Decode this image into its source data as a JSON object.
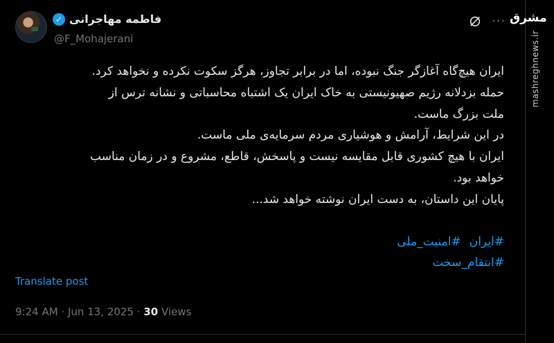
{
  "author": {
    "name": "فاطمه مهاجرانی",
    "handle": "@F_Mohajerani"
  },
  "watermark": {
    "logo": "مشرق",
    "url": "mashreghnews.ir"
  },
  "post": {
    "lines": [
      "ایران هیچ‌گاه آغازگر جنگ نبوده، اما در برابر تجاوز، هرگز سکوت نکرده و نخواهد کرد.",
      "حمله بزدلانه رژیم صهیونیستی به خاک ایران یک اشتباه محاسباتی و نشانه ترس از",
      "ملت بزرگ ماست.",
      "در این شرایط، آرامش و هوشیاری مردم سرمایه‌ی ملی ماست.",
      "ایران با هیچ کشوری قابل مقایسه نیست و پاسخش، قاطع، مشروع و در زمان مناسب",
      "خواهد بود.",
      "پایان این داستان، به دست ایران نوشته خواهد شد..."
    ],
    "hashtags": [
      "#ایران",
      "#امنیت_ملی",
      "#انتقام_سخت"
    ],
    "translate_label": "Translate post",
    "time": "9:24 AM",
    "date": "Jun 13, 2025",
    "separator": "·",
    "views_count": "30",
    "views_label": "Views"
  },
  "icons": {
    "verified": "verified-badge-icon",
    "grok": "grok-icon",
    "more": "more-options-icon"
  },
  "colors": {
    "background": "#000000",
    "text": "#e7e9ea",
    "muted": "#71767b",
    "link": "#1d9bf0"
  }
}
